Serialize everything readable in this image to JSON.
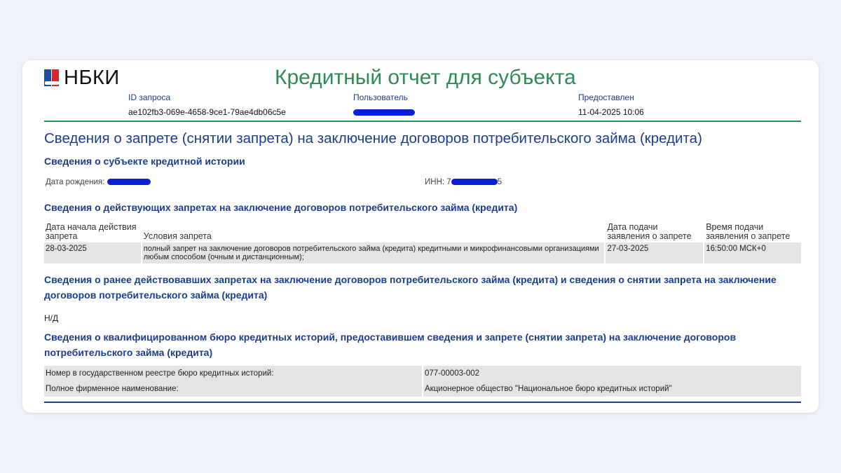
{
  "header": {
    "logo_text": "НБКИ",
    "title": "Кредитный отчет для субъекта",
    "request_id_label": "ID запроса",
    "request_id_value": "ae102fb3-069e-4658-9ce1-79ae4db06c5e",
    "user_label": "Пользователь",
    "provided_label": "Предоставлен",
    "provided_value": "11-04-2025 10:06"
  },
  "section_title": "Сведения о запрете (снятии запрета) на заключение договоров потребительского займа (кредита)",
  "subject": {
    "heading": "Сведения о субъекте кредитной истории",
    "birth_label": "Дата рождения:",
    "inn_label": "ИНН: 7",
    "inn_suffix": "5"
  },
  "active_bans": {
    "heading": "Сведения о действующих запретах на заключение договоров потребительского займа (кредита)",
    "columns": [
      "Дата начала действия запрета",
      "Условия запрета",
      "Дата подачи заявления о запрете",
      "Время подачи заявления о запрете"
    ],
    "rows": [
      {
        "start_date": "28-03-2025",
        "conditions": "полный запрет на заключение договоров потребительского займа (кредита) кредитными и микрофинансовыми организациями любым способом (очным и дистанционным);",
        "application_date": "27-03-2025",
        "application_time": "16:50:00 МСК+0"
      }
    ]
  },
  "previous_bans": {
    "heading": "Сведения о ранее действовавших запретах на заключение договоров потребительского займа (кредита) и сведения о снятии запрета на заключение договоров потребительского займа (кредита)",
    "value": "Н/Д"
  },
  "bureau": {
    "heading": "Сведения о квалифицированном бюро кредитных историй, предоставившем сведения и запрете (снятии запрета) на заключение договоров потребительского займа (кредита)",
    "rows": [
      {
        "label": "Номер в государственном реестре бюро кредитных историй:",
        "value": "077-00003-002"
      },
      {
        "label": "Полное фирменное наименование:",
        "value": "Акционерное общество \"Национальное бюро кредитных историй\""
      }
    ]
  },
  "colors": {
    "title_green": "#2e8b57",
    "heading_blue": "#1a3d8f",
    "redaction": "#0a1ed6",
    "page_bg": "#eef2fb"
  }
}
